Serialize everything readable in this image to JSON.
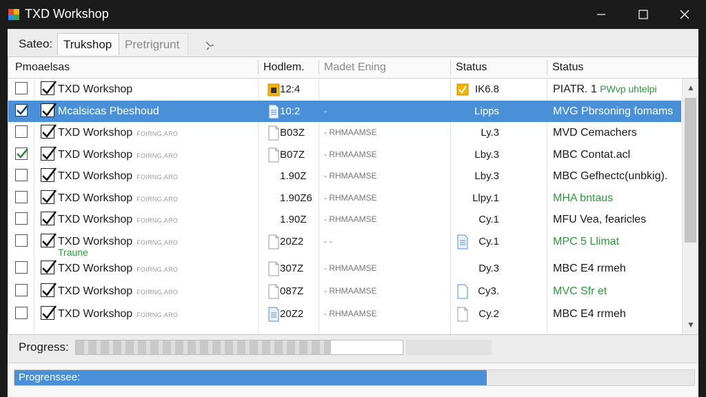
{
  "window": {
    "title": "TXD Workshop",
    "controls": [
      "minimize-icon",
      "maximize-icon",
      "close-icon"
    ]
  },
  "tabs": [
    {
      "label": "Sateo:"
    },
    {
      "label": "Trukshop"
    },
    {
      "label": "Pretrigrunt"
    }
  ],
  "columns": [
    {
      "label": "Pmoaelsas"
    },
    {
      "label": "Hodlem."
    },
    {
      "label": "Madet Ening"
    },
    {
      "label": "Status"
    },
    {
      "label": "Status"
    }
  ],
  "rows": [
    {
      "outer_checked": false,
      "name": "TXD Workshop",
      "sub": "",
      "note": "",
      "file_icon": "folder",
      "hval": "12:4",
      "mval": "",
      "s1_icon": "checkbox-orange",
      "s1": "IK6.8",
      "s2": "PIATR. 1",
      "s2_extra": "PWvp uhtelpi",
      "s2_green": false,
      "selected": false
    },
    {
      "outer_checked": true,
      "name": "Mcalsicas Pbeshoud",
      "sub": "",
      "note": "",
      "file_icon": "doc",
      "hval": "10:2",
      "mval": "-",
      "s1_icon": "",
      "s1": "Lipps",
      "s2": "MVG Pbrsoning fomams",
      "s2_extra": "",
      "s2_green": false,
      "selected": true
    },
    {
      "outer_checked": false,
      "name": "TXD Workshop",
      "sub": "FOIRNG.ARO",
      "note": "",
      "file_icon": "page",
      "hval": "B03Z",
      "mval": "- RHMAAMSE",
      "s1_icon": "",
      "s1": "Ly.3",
      "s2": "MVD Cemachers",
      "s2_extra": "",
      "s2_green": false,
      "selected": false
    },
    {
      "outer_checked": true,
      "name": "TXD Workshop",
      "sub": "FOIRNG.ARO",
      "note": "",
      "file_icon": "page",
      "hval": "B07Z",
      "mval": "- RHMAAMSE",
      "s1_icon": "",
      "s1": "Lby.3",
      "s2": "MBC Contat.acl",
      "s2_extra": "",
      "s2_green": false,
      "selected": false
    },
    {
      "outer_checked": false,
      "name": "TXD Workshop",
      "sub": "FOIRNG.ARO",
      "note": "",
      "file_icon": "",
      "hval": "1.90Z",
      "mval": "- RHMAAMSE",
      "s1_icon": "",
      "s1": "Lby.3",
      "s2": "MBC Gefhectc(unbkig).",
      "s2_extra": "",
      "s2_green": false,
      "selected": false
    },
    {
      "outer_checked": false,
      "name": "TXD Workshop",
      "sub": "FOIRNG.ARO",
      "note": "",
      "file_icon": "",
      "hval": "1.90Z6",
      "mval": "- RHMAAMSE",
      "s1_icon": "",
      "s1": "Llpy.1",
      "s2": "MHA bntaus",
      "s2_extra": "",
      "s2_green": true,
      "selected": false
    },
    {
      "outer_checked": false,
      "name": "TXD Workshop",
      "sub": "FOIRNG.ARO",
      "note": "",
      "file_icon": "",
      "hval": "1.90Z",
      "mval": "- RHMAAMSE",
      "s1_icon": "",
      "s1": "Cy.1",
      "s2": "MFU Vea, fearicles",
      "s2_extra": "",
      "s2_green": false,
      "selected": false
    },
    {
      "outer_checked": false,
      "name": "TXD Workshop",
      "sub": "FOIRNG.ARO",
      "note": "Traune",
      "file_icon": "page",
      "hval": "20Z2",
      "mval": "- -",
      "s1_icon": "doc-blue",
      "s1": "Cy.1",
      "s2": "MPC 5 Llimat",
      "s2_extra": "",
      "s2_green": true,
      "selected": false
    },
    {
      "outer_checked": false,
      "name": "TXD Workshop",
      "sub": "FOIRNG.ARO",
      "note": "",
      "file_icon": "page",
      "hval": "307Z",
      "mval": "- RHMAAMSE",
      "s1_icon": "",
      "s1": "Dy.3",
      "s2": "MBC E4 rrmeh",
      "s2_extra": "",
      "s2_green": false,
      "selected": false
    },
    {
      "outer_checked": false,
      "name": "TXD Workshop",
      "sub": "FOIRNG.ARO",
      "note": "",
      "file_icon": "page",
      "hval": "087Z",
      "mval": "- RHMAAMSE",
      "s1_icon": "page-blue",
      "s1": "Cy3.",
      "s2": "MVC Sfr et",
      "s2_extra": "",
      "s2_green": true,
      "selected": false
    },
    {
      "outer_checked": false,
      "name": "TXD Workshop",
      "sub": "FOIRNG.ARO",
      "note": "",
      "file_icon": "doc-blue",
      "hval": "20Z2",
      "mval": "- RHMAAMSE",
      "s1_icon": "page",
      "s1": "Cy.2",
      "s2": "MBC E4 rrmeh",
      "s2_extra": "",
      "s2_green": false,
      "selected": false
    }
  ],
  "progress": {
    "label": "Progress:",
    "fraction": 0.78
  },
  "overall": {
    "label": "Progrenssee:",
    "fraction": 0.695
  },
  "colors": {
    "accent": "#4a90d9",
    "green": "#2a9a3a",
    "titlebar": "#1b1b1b"
  }
}
